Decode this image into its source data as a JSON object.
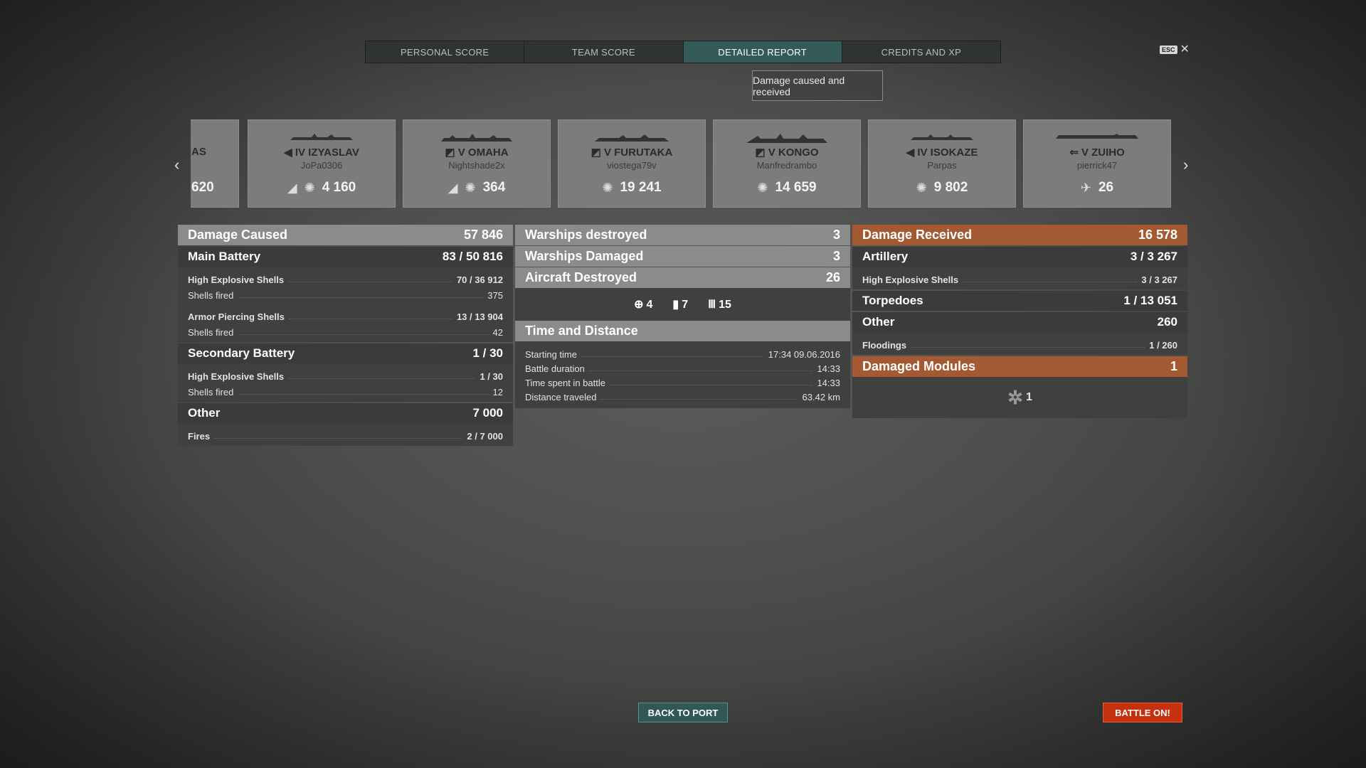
{
  "tabs": [
    {
      "label": "PERSONAL SCORE"
    },
    {
      "label": "TEAM SCORE"
    },
    {
      "label": "DETAILED REPORT"
    },
    {
      "label": "CREDITS AND XP"
    }
  ],
  "esc": {
    "key": "ESC",
    "close": "✕"
  },
  "subtitle": "Damage caused and received",
  "cards": [
    {
      "name": "AS",
      "player": "",
      "value": "620"
    },
    {
      "name": "IV IZYASLAV",
      "player": "JoPa0306",
      "value": "4 160"
    },
    {
      "name": "V OMAHA",
      "player": "Nightshade2x",
      "value": "364"
    },
    {
      "name": "V FURUTAKA",
      "player": "viostega79v",
      "value": "19 241"
    },
    {
      "name": "V KONGO",
      "player": "Manfredrambo",
      "value": "14 659"
    },
    {
      "name": "IV ISOKAZE",
      "player": "Parpas",
      "value": "9 802"
    },
    {
      "name": "V ZUIHO",
      "player": "pierrick47",
      "value": "26"
    }
  ],
  "left": {
    "damage_caused": {
      "label": "Damage Caused",
      "value": "57 846"
    },
    "main_battery": {
      "label": "Main Battery",
      "value": "83 / 50 816",
      "he": {
        "label": "High Explosive Shells",
        "value": "70 / 36 912"
      },
      "he_fired": {
        "label": "Shells fired",
        "value": "375"
      },
      "ap": {
        "label": "Armor Piercing Shells",
        "value": "13 / 13 904"
      },
      "ap_fired": {
        "label": "Shells fired",
        "value": "42"
      }
    },
    "secondary": {
      "label": "Secondary Battery",
      "value": "1 / 30",
      "he": {
        "label": "High Explosive Shells",
        "value": "1 / 30"
      },
      "fired": {
        "label": "Shells fired",
        "value": "12"
      }
    },
    "other": {
      "label": "Other",
      "value": "7 000",
      "fires": {
        "label": "Fires",
        "value": "2 / 7 000"
      }
    }
  },
  "middle": {
    "destroyed": {
      "label": "Warships destroyed",
      "value": "3"
    },
    "damaged": {
      "label": "Warships Damaged",
      "value": "3"
    },
    "aircraft": {
      "label": "Aircraft Destroyed",
      "value": "26"
    },
    "aircraft_icons": {
      "a": "4",
      "b": "7",
      "c": "15"
    },
    "time": {
      "label": "Time and Distance",
      "start": {
        "label": "Starting time",
        "value": "17:34  09.06.2016"
      },
      "duration": {
        "label": "Battle duration",
        "value": "14:33"
      },
      "spent": {
        "label": "Time spent in battle",
        "value": "14:33"
      },
      "distance": {
        "label": "Distance traveled",
        "value": "63.42 km"
      }
    }
  },
  "right": {
    "received": {
      "label": "Damage Received",
      "value": "16 578"
    },
    "artillery": {
      "label": "Artillery",
      "value": "3 / 3 267",
      "he": {
        "label": "High Explosive Shells",
        "value": "3 / 3 267"
      }
    },
    "torpedoes": {
      "label": "Torpedoes",
      "value": "1 / 13 051"
    },
    "other": {
      "label": "Other",
      "value": "260",
      "flood": {
        "label": "Floodings",
        "value": "1 / 260"
      }
    },
    "modules": {
      "label": "Damaged Modules",
      "value": "1",
      "count": "1"
    }
  },
  "buttons": {
    "port": "BACK TO PORT",
    "battle": "BATTLE ON!"
  },
  "colors": {
    "accent_tab": "#335a57",
    "received": "#a35a32",
    "battle": "#c5300f"
  }
}
